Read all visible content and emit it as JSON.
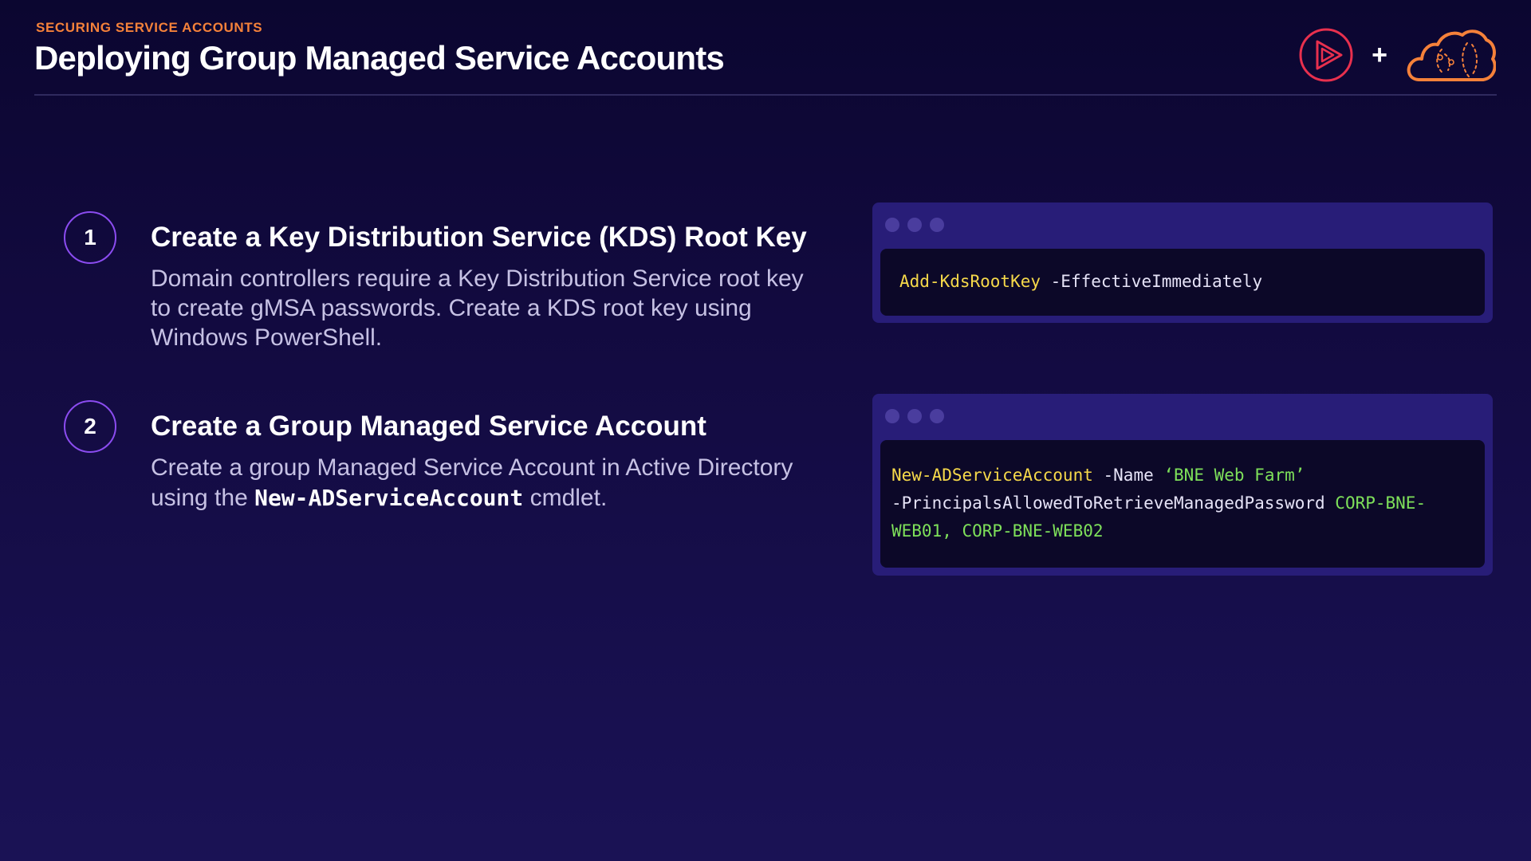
{
  "header": {
    "eyebrow": "SECURING SERVICE ACCOUNTS",
    "title": "Deploying Group Managed Service Accounts",
    "logo_joiner": "+"
  },
  "steps": [
    {
      "number": "1",
      "title": "Create a Key Distribution Service (KDS) Root Key",
      "description": "Domain controllers require a Key Distribution Service root key to create gMSA passwords. Create a KDS root key using Windows PowerShell."
    },
    {
      "number": "2",
      "title": "Create a Group Managed Service Account",
      "description_before": "Create a group Managed Service Account in Active Directory using the ",
      "description_code": "New-ADServiceAccount",
      "description_after": " cmdlet."
    }
  ],
  "code_blocks": [
    {
      "cmdlet": "Add-KdsRootKey",
      "params": " -EffectiveImmediately"
    },
    {
      "cmdlet": "New-ADServiceAccount",
      "name_param": " -Name ",
      "name_value": "‘BNE Web Farm’",
      "principals_param": "\n-PrincipalsAllowedToRetrieveManagedPassword ",
      "principals_value": "CORP-BNE-WEB01, CORP-BNE-WEB02"
    }
  ],
  "colors": {
    "accent_orange": "#f5813a",
    "step_circle": "#8b4cf0",
    "code_cmdlet": "#f6d94a",
    "code_string": "#7ee05a",
    "logo_red": "#e8304e"
  },
  "icons": {
    "left_logo": "play-circle-logo",
    "right_logo": "cloud-logo"
  }
}
